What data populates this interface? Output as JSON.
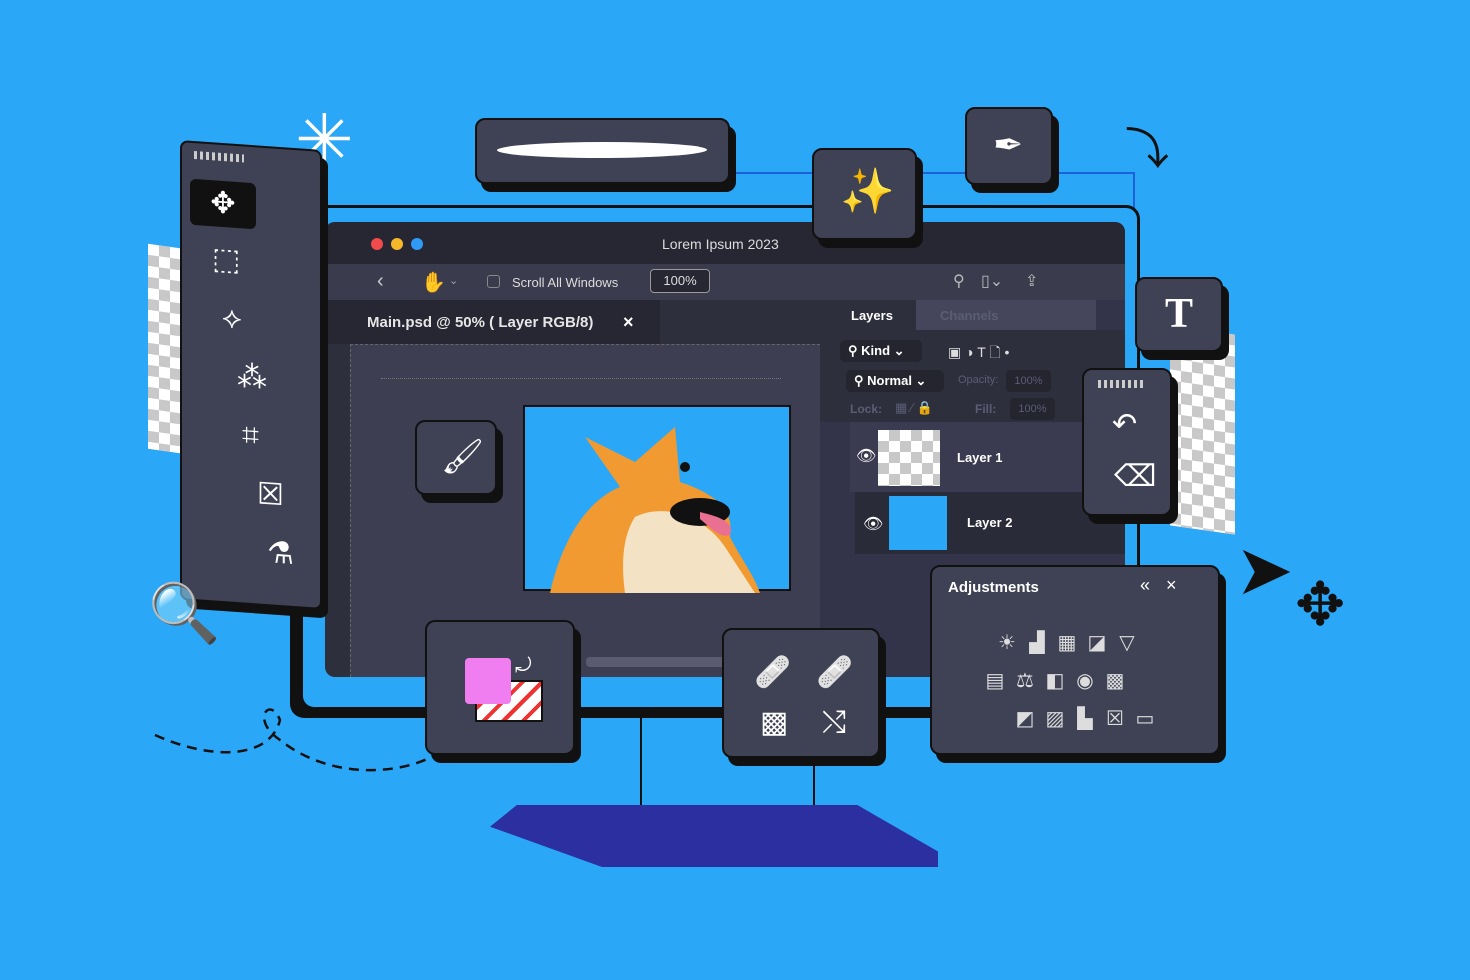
{
  "window": {
    "title": "Lorem Ipsum 2023",
    "traffic_colors": [
      "#f04a4a",
      "#f5b82a",
      "#2f9bf7"
    ]
  },
  "toolbar": {
    "scroll_all_windows": "Scroll All Windows",
    "scroll_all_checked": false,
    "zoom": "100%"
  },
  "document": {
    "tab_label": "Main.psd @ 50% ( Layer RGB/8)",
    "close": "×"
  },
  "layers": {
    "tabs": [
      {
        "label": "Layers",
        "active": true
      },
      {
        "label": "Channels",
        "active": false
      }
    ],
    "filter": "Kind",
    "blend_mode": "Normal",
    "opacity_label": "Opacity:",
    "opacity": "100%",
    "lock_label": "Lock:",
    "fill_label": "Fill:",
    "fill": "100%",
    "items": [
      {
        "name": "Layer 1",
        "visible": true
      },
      {
        "name": "Layer 2",
        "visible": true
      }
    ]
  },
  "adjustments": {
    "title": "Adjustments",
    "collapse": "«",
    "close": "×",
    "rows": [
      [
        "☀",
        "▟",
        "▦",
        "◪",
        "▽"
      ],
      [
        "▤",
        "⚖",
        "◧",
        "◉",
        "▩"
      ],
      [
        "◩",
        "▨",
        "▙",
        "☒",
        "▭"
      ]
    ]
  },
  "tools": [
    "move-icon",
    "marquee-icon",
    "lasso-icon",
    "magic-wand-icon",
    "crop-icon",
    "frame-icon",
    "eyedropper-icon"
  ],
  "colors": {
    "background": "#2aa7f6",
    "panel": "#3f4154",
    "screen": "#2e2f3d",
    "accent": "#2aa7f6",
    "swatch": "#f07ef0"
  }
}
